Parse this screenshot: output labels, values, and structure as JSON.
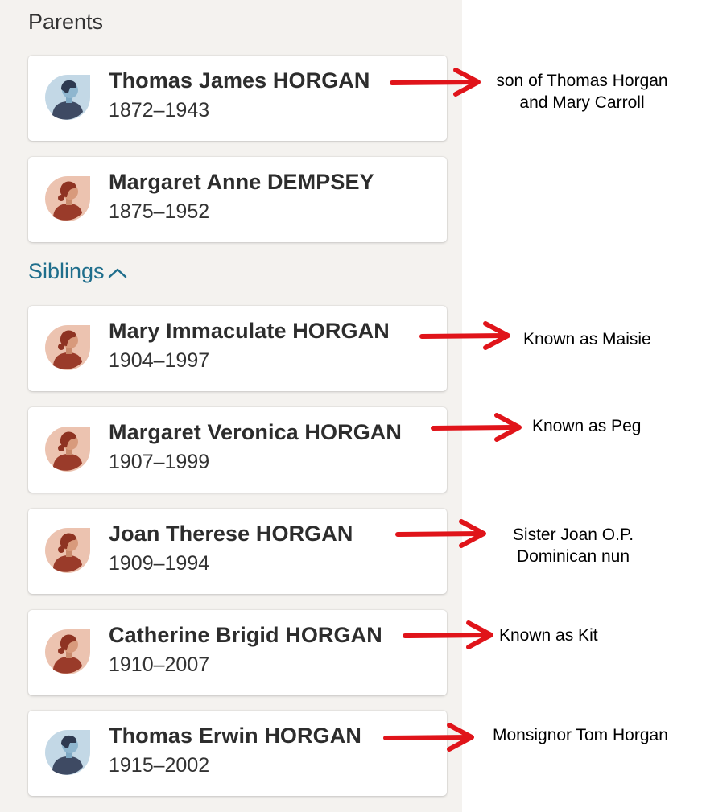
{
  "parents": {
    "title": "Parents",
    "people": [
      {
        "name": "Thomas James HORGAN",
        "dates": "1872–1943",
        "gender": "male"
      },
      {
        "name": "Margaret Anne DEMPSEY",
        "dates": "1875–1952",
        "gender": "female"
      }
    ]
  },
  "siblings": {
    "title": "Siblings",
    "toggle_icon": "chevron-up-icon",
    "people": [
      {
        "name": "Mary Immaculate HORGAN",
        "dates": "1904–1997",
        "gender": "female"
      },
      {
        "name": "Margaret Veronica HORGAN",
        "dates": "1907–1999",
        "gender": "female"
      },
      {
        "name": "Joan Therese HORGAN",
        "dates": "1909–1994",
        "gender": "female"
      },
      {
        "name": "Catherine Brigid HORGAN",
        "dates": "1910–2007",
        "gender": "male_placeholder_fix"
      },
      {
        "name": "Thomas Erwin HORGAN",
        "dates": "1915–2002",
        "gender": "male"
      }
    ]
  },
  "annotations": {
    "thomas_james": {
      "line1": "son of Thomas Horgan",
      "line2": "and Mary Carroll"
    },
    "mary": {
      "line1": "Known as Maisie"
    },
    "margaret_veronica": {
      "line1": "Known as Peg"
    },
    "joan": {
      "line1": "Sister Joan O.P.",
      "line2": "Dominican nun"
    },
    "catherine": {
      "line1": "Known as Kit"
    },
    "thomas_erwin": {
      "line1": "Monsignor Tom Horgan"
    }
  },
  "colors": {
    "panel_bg": "#f4f2ef",
    "link": "#1f6e8c",
    "arrow": "#e0141a",
    "male_avatar_bg": "#c3d8e6",
    "female_avatar_bg": "#ecc3b0"
  }
}
